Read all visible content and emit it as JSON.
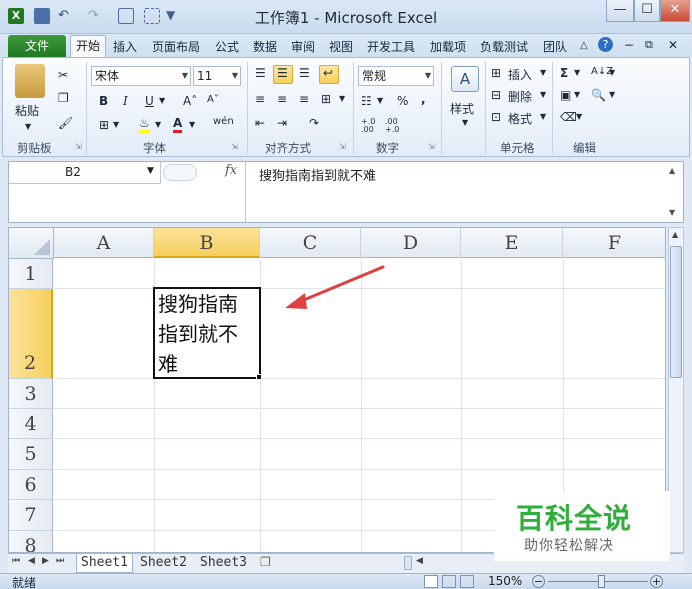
{
  "window": {
    "title": "工作簿1 - Microsoft Excel",
    "controls": [
      "—",
      "☐",
      "✕"
    ]
  },
  "tabs": [
    "文件",
    "开始",
    "插入",
    "页面布局",
    "公式",
    "数据",
    "审阅",
    "视图",
    "开发工具",
    "加载项",
    "负载测试",
    "团队"
  ],
  "ribbon": {
    "clipboard": {
      "label": "剪贴板",
      "paste": "粘贴"
    },
    "font": {
      "label": "字体",
      "name": "宋体",
      "size": "11",
      "bold": "B",
      "italic": "I",
      "underline": "U",
      "grow": "A˄",
      "shrink": "A˅",
      "phonetic": "wén"
    },
    "alignment": {
      "label": "对齐方式"
    },
    "number": {
      "label": "数字",
      "format": "常规",
      "percent": "%",
      "comma": ",",
      "inc": "+.0 .00",
      "dec": ".00 +.0"
    },
    "styles": {
      "label": "样式",
      "style": "样式"
    },
    "cells": {
      "label": "单元格",
      "insert": "插入",
      "delete": "删除",
      "format": "格式"
    },
    "editing": {
      "label": "编辑",
      "sum": "Σ",
      "sort": "A↓Z",
      "find": "字"
    }
  },
  "formula_bar": {
    "name_box": "B2",
    "fx": "fx",
    "formula": "搜狗指南指到就不难"
  },
  "grid": {
    "columns": [
      "A",
      "B",
      "C",
      "D",
      "E",
      "F"
    ],
    "rows": [
      "1",
      "2",
      "3",
      "4",
      "5",
      "6",
      "7",
      "8"
    ],
    "selected_cell": "B2",
    "cell_b2_lines": [
      "搜狗指南",
      "指到就不",
      "难"
    ]
  },
  "sheets": [
    "Sheet1",
    "Sheet2",
    "Sheet3"
  ],
  "status": {
    "mode": "就绪",
    "zoom": "150%"
  },
  "watermark": {
    "brand": "百科全说",
    "tagline": "助你轻松解决"
  },
  "colors": {
    "accent_green": "#1f7a22",
    "selection_header": "#f9d66e",
    "arrow": "#e04040",
    "watermark_green": "#2eae3a"
  }
}
